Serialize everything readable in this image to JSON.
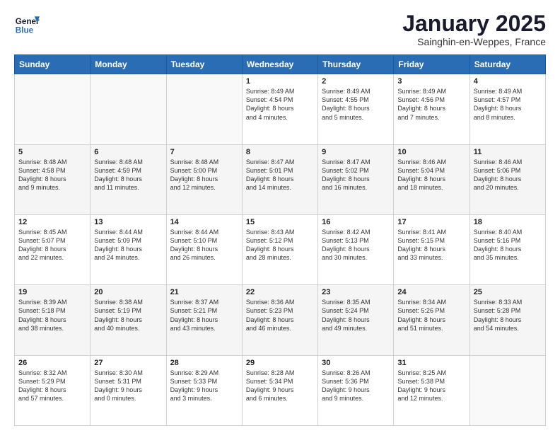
{
  "header": {
    "logo_general": "General",
    "logo_blue": "Blue",
    "month_title": "January 2025",
    "location": "Sainghin-en-Weppes, France"
  },
  "weekdays": [
    "Sunday",
    "Monday",
    "Tuesday",
    "Wednesday",
    "Thursday",
    "Friday",
    "Saturday"
  ],
  "weeks": [
    [
      {
        "day": "",
        "content": ""
      },
      {
        "day": "",
        "content": ""
      },
      {
        "day": "",
        "content": ""
      },
      {
        "day": "1",
        "content": "Sunrise: 8:49 AM\nSunset: 4:54 PM\nDaylight: 8 hours\nand 4 minutes."
      },
      {
        "day": "2",
        "content": "Sunrise: 8:49 AM\nSunset: 4:55 PM\nDaylight: 8 hours\nand 5 minutes."
      },
      {
        "day": "3",
        "content": "Sunrise: 8:49 AM\nSunset: 4:56 PM\nDaylight: 8 hours\nand 7 minutes."
      },
      {
        "day": "4",
        "content": "Sunrise: 8:49 AM\nSunset: 4:57 PM\nDaylight: 8 hours\nand 8 minutes."
      }
    ],
    [
      {
        "day": "5",
        "content": "Sunrise: 8:48 AM\nSunset: 4:58 PM\nDaylight: 8 hours\nand 9 minutes."
      },
      {
        "day": "6",
        "content": "Sunrise: 8:48 AM\nSunset: 4:59 PM\nDaylight: 8 hours\nand 11 minutes."
      },
      {
        "day": "7",
        "content": "Sunrise: 8:48 AM\nSunset: 5:00 PM\nDaylight: 8 hours\nand 12 minutes."
      },
      {
        "day": "8",
        "content": "Sunrise: 8:47 AM\nSunset: 5:01 PM\nDaylight: 8 hours\nand 14 minutes."
      },
      {
        "day": "9",
        "content": "Sunrise: 8:47 AM\nSunset: 5:02 PM\nDaylight: 8 hours\nand 16 minutes."
      },
      {
        "day": "10",
        "content": "Sunrise: 8:46 AM\nSunset: 5:04 PM\nDaylight: 8 hours\nand 18 minutes."
      },
      {
        "day": "11",
        "content": "Sunrise: 8:46 AM\nSunset: 5:06 PM\nDaylight: 8 hours\nand 20 minutes."
      }
    ],
    [
      {
        "day": "12",
        "content": "Sunrise: 8:45 AM\nSunset: 5:07 PM\nDaylight: 8 hours\nand 22 minutes."
      },
      {
        "day": "13",
        "content": "Sunrise: 8:44 AM\nSunset: 5:09 PM\nDaylight: 8 hours\nand 24 minutes."
      },
      {
        "day": "14",
        "content": "Sunrise: 8:44 AM\nSunset: 5:10 PM\nDaylight: 8 hours\nand 26 minutes."
      },
      {
        "day": "15",
        "content": "Sunrise: 8:43 AM\nSunset: 5:12 PM\nDaylight: 8 hours\nand 28 minutes."
      },
      {
        "day": "16",
        "content": "Sunrise: 8:42 AM\nSunset: 5:13 PM\nDaylight: 8 hours\nand 30 minutes."
      },
      {
        "day": "17",
        "content": "Sunrise: 8:41 AM\nSunset: 5:15 PM\nDaylight: 8 hours\nand 33 minutes."
      },
      {
        "day": "18",
        "content": "Sunrise: 8:40 AM\nSunset: 5:16 PM\nDaylight: 8 hours\nand 35 minutes."
      }
    ],
    [
      {
        "day": "19",
        "content": "Sunrise: 8:39 AM\nSunset: 5:18 PM\nDaylight: 8 hours\nand 38 minutes."
      },
      {
        "day": "20",
        "content": "Sunrise: 8:38 AM\nSunset: 5:19 PM\nDaylight: 8 hours\nand 40 minutes."
      },
      {
        "day": "21",
        "content": "Sunrise: 8:37 AM\nSunset: 5:21 PM\nDaylight: 8 hours\nand 43 minutes."
      },
      {
        "day": "22",
        "content": "Sunrise: 8:36 AM\nSunset: 5:23 PM\nDaylight: 8 hours\nand 46 minutes."
      },
      {
        "day": "23",
        "content": "Sunrise: 8:35 AM\nSunset: 5:24 PM\nDaylight: 8 hours\nand 49 minutes."
      },
      {
        "day": "24",
        "content": "Sunrise: 8:34 AM\nSunset: 5:26 PM\nDaylight: 8 hours\nand 51 minutes."
      },
      {
        "day": "25",
        "content": "Sunrise: 8:33 AM\nSunset: 5:28 PM\nDaylight: 8 hours\nand 54 minutes."
      }
    ],
    [
      {
        "day": "26",
        "content": "Sunrise: 8:32 AM\nSunset: 5:29 PM\nDaylight: 8 hours\nand 57 minutes."
      },
      {
        "day": "27",
        "content": "Sunrise: 8:30 AM\nSunset: 5:31 PM\nDaylight: 9 hours\nand 0 minutes."
      },
      {
        "day": "28",
        "content": "Sunrise: 8:29 AM\nSunset: 5:33 PM\nDaylight: 9 hours\nand 3 minutes."
      },
      {
        "day": "29",
        "content": "Sunrise: 8:28 AM\nSunset: 5:34 PM\nDaylight: 9 hours\nand 6 minutes."
      },
      {
        "day": "30",
        "content": "Sunrise: 8:26 AM\nSunset: 5:36 PM\nDaylight: 9 hours\nand 9 minutes."
      },
      {
        "day": "31",
        "content": "Sunrise: 8:25 AM\nSunset: 5:38 PM\nDaylight: 9 hours\nand 12 minutes."
      },
      {
        "day": "",
        "content": ""
      }
    ]
  ]
}
